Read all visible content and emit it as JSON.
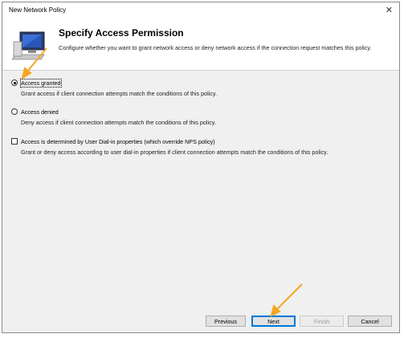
{
  "window": {
    "title": "New Network Policy",
    "close_glyph": "✕"
  },
  "header": {
    "heading": "Specify Access Permission",
    "description": "Configure whether you want to grant network access or deny network access if the connection request matches this policy.",
    "icon": "network-computer-icon"
  },
  "options": {
    "granted": {
      "label": "Access granted",
      "description": "Grant access if client connection attempts match the conditions of this policy.",
      "selected": true
    },
    "denied": {
      "label": "Access denied",
      "description": "Deny access if client connection attempts match the conditions of this policy.",
      "selected": false
    },
    "dialin": {
      "label": "Access is determined by User Dial-in properties (which override NPS policy)",
      "description": "Grant or deny access according to user dial-in properties if client connection attempts match the conditions of this policy.",
      "checked": false
    }
  },
  "buttons": {
    "previous": "Previous",
    "next": "Next",
    "finish": "Finish",
    "cancel": "Cancel"
  },
  "annotation_color": "#f5a623"
}
